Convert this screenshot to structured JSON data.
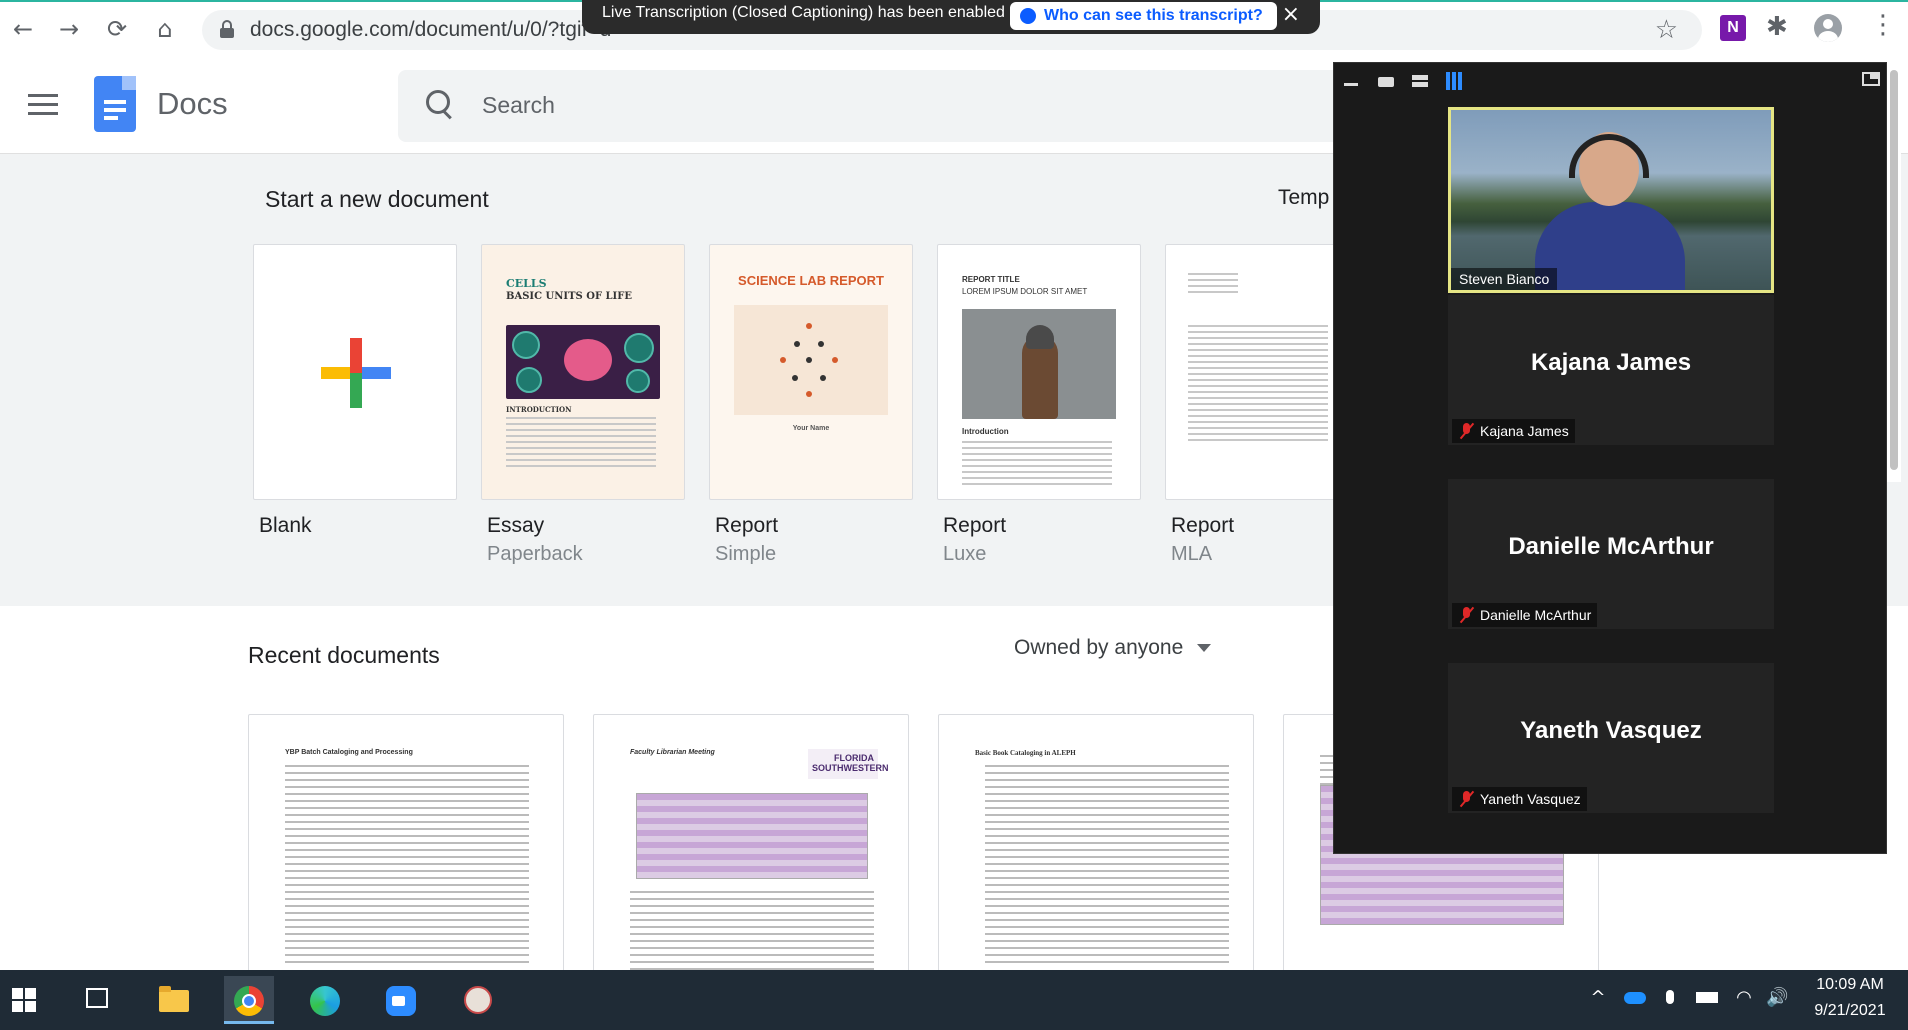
{
  "browser": {
    "url": "docs.google.com/document/u/0/?tgif=d",
    "nav": {
      "back": "←",
      "forward": "→",
      "reload": "⟳",
      "home": "⌂"
    },
    "star": "☆",
    "extensions": {
      "onenote_letter": "N",
      "puzzle": "✱"
    },
    "menu": "⋮"
  },
  "transcription_banner": {
    "message": "Live Transcription (Closed Captioning) has been enabled",
    "link": "Who can see this transcript?",
    "close": "×"
  },
  "docs": {
    "app_name": "Docs",
    "search_placeholder": "Search",
    "start_title": "Start a new document",
    "template_gallery": "Temp",
    "templates": [
      {
        "name": "Blank",
        "sub": ""
      },
      {
        "name": "Essay",
        "sub": "Paperback"
      },
      {
        "name": "Report",
        "sub": "Simple"
      },
      {
        "name": "Report",
        "sub": "Luxe"
      },
      {
        "name": "Report",
        "sub": "MLA"
      }
    ],
    "essay_thumb": {
      "title1": "CELLS",
      "title2": "BASIC UNITS OF LIFE",
      "section": "INTRODUCTION"
    },
    "science_thumb": {
      "title": "SCIENCE LAB REPORT",
      "footer": "Your Name"
    },
    "luxe_thumb": {
      "title1": "REPORT TITLE",
      "title2": "LOREM IPSUM DOLOR SIT AMET",
      "section": "Introduction"
    },
    "recent_title": "Recent documents",
    "owner_filter": "Owned by anyone",
    "recent_docs": [
      {
        "heading": "YBP Batch Cataloging and Processing"
      },
      {
        "heading": "Faculty Librarian Meeting",
        "logo": "FLORIDA SOUTHWESTERN"
      },
      {
        "heading": "Basic Book Cataloging in ALEPH"
      },
      {
        "heading": ""
      }
    ]
  },
  "zoom": {
    "speaker": "Steven Bianco",
    "participants": [
      {
        "name": "Kajana James",
        "label": "Kajana James"
      },
      {
        "name": "Danielle McArthur",
        "label": "Danielle McArthur"
      },
      {
        "name": "Yaneth Vasquez",
        "label": "Yaneth Vasquez"
      }
    ]
  },
  "taskbar": {
    "time": "10:09 AM",
    "date": "9/21/2021",
    "tray": {
      "chevron": "^",
      "volume": "🔊",
      "wifi": "◠"
    }
  },
  "colors": {
    "docs_blue": "#4285f4",
    "zoom_blue": "#0b5cff",
    "active_speaker_border": "#e5e584",
    "muted_red": "#e02828"
  }
}
